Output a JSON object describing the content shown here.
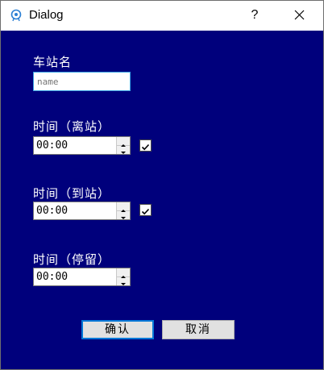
{
  "window": {
    "title": "Dialog",
    "help_label": "?"
  },
  "station": {
    "label": "车站名",
    "placeholder": "name",
    "value": ""
  },
  "departure": {
    "label": "时间（离站）",
    "time": "00:00",
    "checked": true
  },
  "arrival": {
    "label": "时间（到站）",
    "time": "00:00",
    "checked": true
  },
  "stop": {
    "label": "时间（停留）",
    "time": "00:00"
  },
  "buttons": {
    "ok": "确认",
    "cancel": "取消"
  },
  "colors": {
    "background": "#00007c",
    "accent": "#0078d7",
    "input_focus_border": "#3aa3e3"
  },
  "icons": {
    "app": "dialog-app-icon",
    "close": "close-icon",
    "spin_up": "spin-up-icon",
    "spin_down": "spin-down-icon",
    "check": "checkmark-icon"
  }
}
